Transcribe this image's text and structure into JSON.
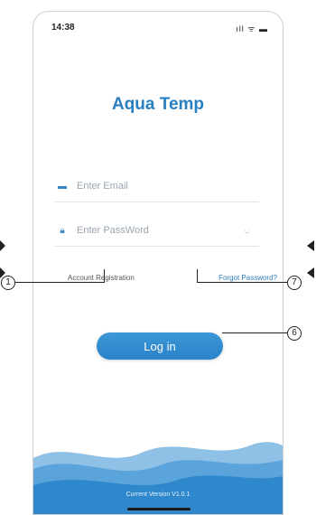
{
  "status_bar": {
    "time": "14:38",
    "icons": "ıll ᯤ ▬"
  },
  "app": {
    "title": "Aqua Temp"
  },
  "form": {
    "email_placeholder": "Enter Email",
    "password_placeholder": "Enter PassWord",
    "password_toggle": "eye"
  },
  "links": {
    "registration": "Account Registration",
    "forgot_password": "Forgot Password?"
  },
  "login_button": "Log in",
  "footer": {
    "version": "Current Version V1.0.1"
  },
  "callouts": {
    "one": "1",
    "six": "6",
    "seven": "7"
  },
  "colors": {
    "accent": "#2a7fc0",
    "button": "#3c98d8",
    "wave": "#2f88cc"
  }
}
